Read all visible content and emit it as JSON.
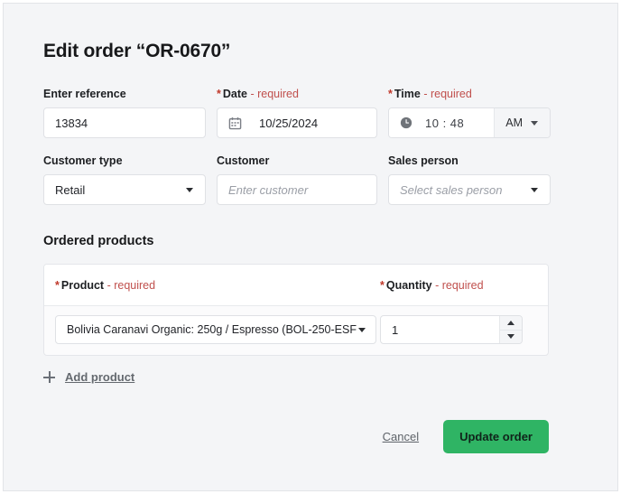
{
  "dialog": {
    "title": "Edit order “OR-0670”"
  },
  "fields": {
    "reference": {
      "label": "Enter reference",
      "value": "13834"
    },
    "date": {
      "label": "Date",
      "required_marker": "*",
      "required_text": "- required",
      "value": "10/25/2024",
      "icon": "calendar-icon"
    },
    "time": {
      "label": "Time",
      "required_marker": "*",
      "required_text": "- required",
      "value": "10 : 48",
      "meridiem": "AM",
      "icon": "clock-icon"
    },
    "customer_type": {
      "label": "Customer type",
      "value": "Retail"
    },
    "customer": {
      "label": "Customer",
      "placeholder": "Enter customer",
      "value": ""
    },
    "sales_person": {
      "label": "Sales person",
      "placeholder": "Select sales person",
      "value": ""
    }
  },
  "ordered_products": {
    "section_title": "Ordered products",
    "columns": {
      "product": {
        "label": "Product",
        "required_marker": "*",
        "required_text": "- required"
      },
      "quantity": {
        "label": "Quantity",
        "required_marker": "*",
        "required_text": "- required"
      }
    },
    "rows": [
      {
        "product": "Bolivia Caranavi Organic: 250g / Espresso (BOL-250-ESF",
        "quantity": "1"
      }
    ],
    "add_product_label": "Add product"
  },
  "footer": {
    "cancel_label": "Cancel",
    "submit_label": "Update order"
  },
  "colors": {
    "accent_green": "#2fb464",
    "required_red": "#c0504d",
    "page_background": "#f4f5f7"
  }
}
